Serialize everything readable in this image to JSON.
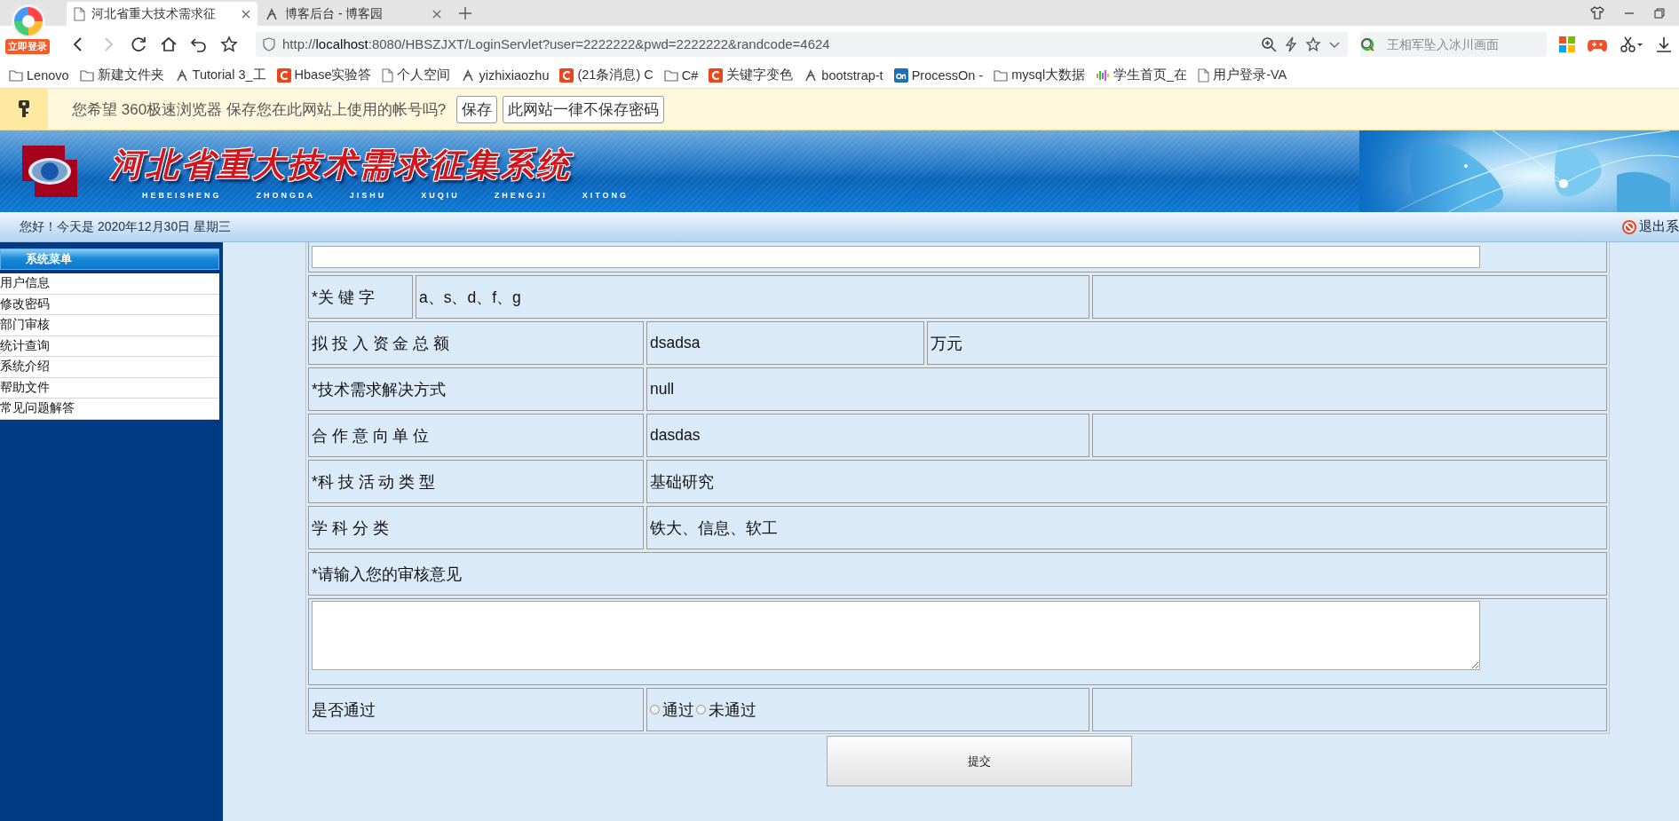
{
  "browser": {
    "account_badge": "立即登录",
    "tabs": [
      {
        "title": "河北省重大技术需求征",
        "selected": true,
        "kind": "page"
      },
      {
        "title": "博客后台 - 博客园",
        "selected": false,
        "kind": "blog"
      }
    ],
    "back": {
      "disabled": false
    },
    "forward": {
      "disabled": true
    },
    "address": "http://**localhost**:8080/HBSZJXT/LoginServlet?user=2222222&pwd=2222222&randcode=4624",
    "search": {
      "placeholder": "王相军坠入冰川画面"
    },
    "bookmarks": [
      {
        "kind": "folder",
        "label": "Lenovo"
      },
      {
        "kind": "folder",
        "label": "新建文件夹"
      },
      {
        "kind": "blog",
        "label": "Tutorial 3_工"
      },
      {
        "kind": "csdn",
        "label": "Hbase实验答"
      },
      {
        "kind": "doc",
        "label": "个人空间"
      },
      {
        "kind": "blog",
        "label": "yizhixiaozhu"
      },
      {
        "kind": "csdn",
        "label": "(21条消息) C"
      },
      {
        "kind": "folder",
        "label": "C#"
      },
      {
        "kind": "csdn",
        "label": "关键字变色"
      },
      {
        "kind": "blog",
        "label": "bootstrap-t"
      },
      {
        "kind": "processon",
        "label": "ProcessOn -"
      },
      {
        "kind": "folder",
        "label": "mysql大数据"
      },
      {
        "kind": "signal",
        "label": "学生首页_在"
      },
      {
        "kind": "doc",
        "label": "用户登录-VA"
      }
    ]
  },
  "password_bar": {
    "message": "您希望 360极速浏览器 保存您在此网站上使用的帐号吗?",
    "buttons": [
      "保存",
      "此网站一律不保存密码"
    ]
  },
  "banner": {
    "title": "河北省重大技术需求征集系统",
    "subtitle": "HEBEISHENG  ZHONGDA  JISHU  XUQIU  ZHENGJI  XITONG"
  },
  "status_bar": {
    "greeting": "您好！今天是 2020年12月30日 星期三",
    "logout": "退出系"
  },
  "sidebar": {
    "title": "系统菜单",
    "items": [
      "用户信息",
      "修改密码",
      "部门审核",
      "统计查询",
      "系统介绍",
      "帮助文件",
      "常见问题解答"
    ]
  },
  "form": {
    "rows": [
      {
        "kind": "top_comment"
      },
      {
        "kind": "keyword",
        "label": "*关 键 字",
        "value": "a、s、d、f、g"
      },
      {
        "kind": "amount",
        "label": "拟 投 入 资 金 总 额",
        "value": "dsadsa",
        "unit": "万元"
      },
      {
        "kind": "wide",
        "label": "*技术需求解决方式",
        "value": "null"
      },
      {
        "kind": "pair",
        "label": "合 作 意 向 单 位",
        "value": "dasdas"
      },
      {
        "kind": "wide",
        "label": "*科 技 活 动 类 型",
        "value": "基础研究"
      },
      {
        "kind": "wide",
        "label": "学 科 分 类",
        "value": "铁大、信息、软工"
      },
      {
        "kind": "prompt",
        "label": "*请输入您的审核意见"
      },
      {
        "kind": "comment"
      },
      {
        "kind": "radio",
        "label": "是否通过",
        "options": [
          {
            "label": "通过",
            "selected": false
          },
          {
            "label": "未通过",
            "selected": false
          }
        ]
      }
    ],
    "submit": "提交"
  }
}
